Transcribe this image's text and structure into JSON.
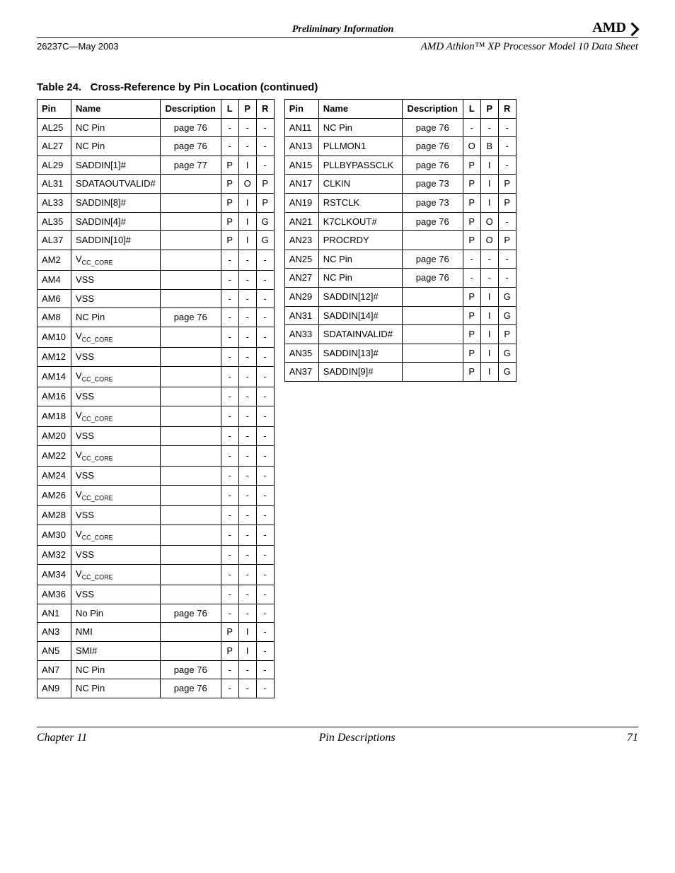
{
  "header": {
    "title": "Preliminary Information",
    "brand": "AMD",
    "doc_id": "26237C—May 2003",
    "doc_title": "AMD Athlon™ XP Processor Model 10 Data Sheet"
  },
  "table": {
    "caption_prefix": "Table 24.",
    "caption_title": "Cross-Reference by Pin Location",
    "caption_suffix": "(continued)",
    "headers": {
      "pin": "Pin",
      "name": "Name",
      "desc": "Description",
      "l": "L",
      "p": "P",
      "r": "R"
    },
    "left_rows": [
      {
        "pin": "AL25",
        "name": "NC Pin",
        "desc": "page 76",
        "l": "-",
        "p": "-",
        "r": "-"
      },
      {
        "pin": "AL27",
        "name": "NC Pin",
        "desc": "page 76",
        "l": "-",
        "p": "-",
        "r": "-"
      },
      {
        "pin": "AL29",
        "name": "SADDIN[1]#",
        "desc": "page 77",
        "l": "P",
        "p": "I",
        "r": "-"
      },
      {
        "pin": "AL31",
        "name": "SDATAOUTVALID#",
        "desc": "",
        "l": "P",
        "p": "O",
        "r": "P"
      },
      {
        "pin": "AL33",
        "name": "SADDIN[8]#",
        "desc": "",
        "l": "P",
        "p": "I",
        "r": "P"
      },
      {
        "pin": "AL35",
        "name": "SADDIN[4]#",
        "desc": "",
        "l": "P",
        "p": "I",
        "r": "G"
      },
      {
        "pin": "AL37",
        "name": "SADDIN[10]#",
        "desc": "",
        "l": "P",
        "p": "I",
        "r": "G"
      },
      {
        "pin": "AM2",
        "name_html": "V<sub class=\"sub\">CC_CORE</sub>",
        "desc": "",
        "l": "-",
        "p": "-",
        "r": "-"
      },
      {
        "pin": "AM4",
        "name": "VSS",
        "desc": "",
        "l": "-",
        "p": "-",
        "r": "-"
      },
      {
        "pin": "AM6",
        "name": "VSS",
        "desc": "",
        "l": "-",
        "p": "-",
        "r": "-"
      },
      {
        "pin": "AM8",
        "name": "NC Pin",
        "desc": "page 76",
        "l": "-",
        "p": "-",
        "r": "-"
      },
      {
        "pin": "AM10",
        "name_html": "V<sub class=\"sub\">CC_CORE</sub>",
        "desc": "",
        "l": "-",
        "p": "-",
        "r": "-"
      },
      {
        "pin": "AM12",
        "name": "VSS",
        "desc": "",
        "l": "-",
        "p": "-",
        "r": "-"
      },
      {
        "pin": "AM14",
        "name_html": "V<sub class=\"sub\">CC_CORE</sub>",
        "desc": "",
        "l": "-",
        "p": "-",
        "r": "-"
      },
      {
        "pin": "AM16",
        "name": "VSS",
        "desc": "",
        "l": "-",
        "p": "-",
        "r": "-"
      },
      {
        "pin": "AM18",
        "name_html": "V<sub class=\"sub\">CC_CORE</sub>",
        "desc": "",
        "l": "-",
        "p": "-",
        "r": "-"
      },
      {
        "pin": "AM20",
        "name": "VSS",
        "desc": "",
        "l": "-",
        "p": "-",
        "r": "-"
      },
      {
        "pin": "AM22",
        "name_html": "V<sub class=\"sub\">CC_CORE</sub>",
        "desc": "",
        "l": "-",
        "p": "-",
        "r": "-"
      },
      {
        "pin": "AM24",
        "name": "VSS",
        "desc": "",
        "l": "-",
        "p": "-",
        "r": "-"
      },
      {
        "pin": "AM26",
        "name_html": "V<sub class=\"sub\">CC_CORE</sub>",
        "desc": "",
        "l": "-",
        "p": "-",
        "r": "-"
      },
      {
        "pin": "AM28",
        "name": "VSS",
        "desc": "",
        "l": "-",
        "p": "-",
        "r": "-"
      },
      {
        "pin": "AM30",
        "name_html": "V<sub class=\"sub\">CC_CORE</sub>",
        "desc": "",
        "l": "-",
        "p": "-",
        "r": "-"
      },
      {
        "pin": "AM32",
        "name": "VSS",
        "desc": "",
        "l": "-",
        "p": "-",
        "r": "-"
      },
      {
        "pin": "AM34",
        "name_html": "V<sub class=\"sub\">CC_CORE</sub>",
        "desc": "",
        "l": "-",
        "p": "-",
        "r": "-"
      },
      {
        "pin": "AM36",
        "name": "VSS",
        "desc": "",
        "l": "-",
        "p": "-",
        "r": "-"
      },
      {
        "pin": "AN1",
        "name": "No Pin",
        "desc": "page 76",
        "l": "-",
        "p": "-",
        "r": "-"
      },
      {
        "pin": "AN3",
        "name": "NMI",
        "desc": "",
        "l": "P",
        "p": "I",
        "r": "-"
      },
      {
        "pin": "AN5",
        "name": "SMI#",
        "desc": "",
        "l": "P",
        "p": "I",
        "r": "-"
      },
      {
        "pin": "AN7",
        "name": "NC Pin",
        "desc": "page 76",
        "l": "-",
        "p": "-",
        "r": "-"
      },
      {
        "pin": "AN9",
        "name": "NC Pin",
        "desc": "page 76",
        "l": "-",
        "p": "-",
        "r": "-"
      }
    ],
    "right_rows": [
      {
        "pin": "AN11",
        "name": "NC Pin",
        "desc": "page 76",
        "l": "-",
        "p": "-",
        "r": "-"
      },
      {
        "pin": "AN13",
        "name": "PLLMON1",
        "desc": "page 76",
        "l": "O",
        "p": "B",
        "r": "-"
      },
      {
        "pin": "AN15",
        "name": "PLLBYPASSCLK",
        "desc": "page 76",
        "l": "P",
        "p": "I",
        "r": "-"
      },
      {
        "pin": "AN17",
        "name": "CLKIN",
        "desc": "page 73",
        "l": "P",
        "p": "I",
        "r": "P"
      },
      {
        "pin": "AN19",
        "name": "RSTCLK",
        "desc": "page 73",
        "l": "P",
        "p": "I",
        "r": "P"
      },
      {
        "pin": "AN21",
        "name": "K7CLKOUT#",
        "desc": "page 76",
        "l": "P",
        "p": "O",
        "r": "-"
      },
      {
        "pin": "AN23",
        "name": "PROCRDY",
        "desc": "",
        "l": "P",
        "p": "O",
        "r": "P"
      },
      {
        "pin": "AN25",
        "name": "NC Pin",
        "desc": "page 76",
        "l": "-",
        "p": "-",
        "r": "-"
      },
      {
        "pin": "AN27",
        "name": "NC Pin",
        "desc": "page 76",
        "l": "-",
        "p": "-",
        "r": "-"
      },
      {
        "pin": "AN29",
        "name": "SADDIN[12]#",
        "desc": "",
        "l": "P",
        "p": "I",
        "r": "G"
      },
      {
        "pin": "AN31",
        "name": "SADDIN[14]#",
        "desc": "",
        "l": "P",
        "p": "I",
        "r": "G"
      },
      {
        "pin": "AN33",
        "name": "SDATAINVALID#",
        "desc": "",
        "l": "P",
        "p": "I",
        "r": "P"
      },
      {
        "pin": "AN35",
        "name": "SADDIN[13]#",
        "desc": "",
        "l": "P",
        "p": "I",
        "r": "G"
      },
      {
        "pin": "AN37",
        "name": "SADDIN[9]#",
        "desc": "",
        "l": "P",
        "p": "I",
        "r": "G"
      }
    ]
  },
  "footer": {
    "chapter": "Chapter 11",
    "section": "Pin Descriptions",
    "page": "71"
  }
}
